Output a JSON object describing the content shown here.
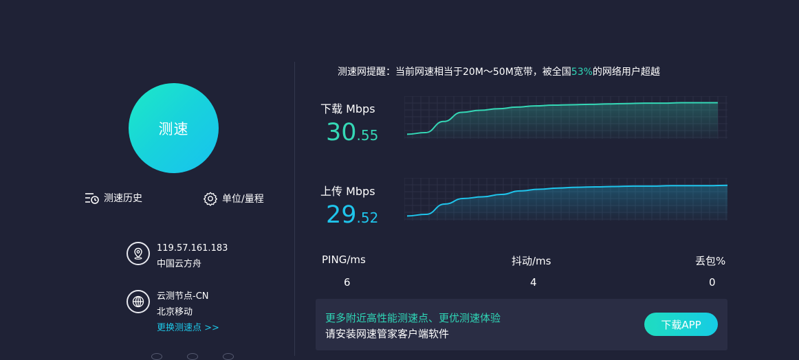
{
  "start_button": {
    "label": "测速"
  },
  "tools": {
    "history_label": "测速历史",
    "settings_label": "单位/量程"
  },
  "ip_info": {
    "ip": "119.57.161.183",
    "isp": "中国云方舟"
  },
  "node_info": {
    "node": "云测节点-CN",
    "carrier": "北京移动",
    "change_link": "更换测速点 >>"
  },
  "tip": {
    "prefix": "测速网提醒：当前网速相当于20M～50M宽带，被全国",
    "percent": "53%",
    "suffix": "的网络用户超越"
  },
  "download": {
    "label": "下载 Mbps",
    "value_int": "30",
    "value_dec": ".55",
    "chart_data": {
      "type": "area",
      "series": [
        {
          "values": [
            0.08,
            0.12,
            0.4,
            0.63,
            0.68,
            0.72,
            0.76,
            0.79,
            0.81,
            0.82,
            0.83,
            0.84,
            0.85,
            0.86,
            0.86,
            0.87,
            0.87,
            0.87
          ]
        }
      ],
      "grid": true,
      "color": "#35d8b6"
    }
  },
  "upload": {
    "label": "上传 Mbps",
    "value_int": "29",
    "value_dec": ".52",
    "chart_data": {
      "type": "area",
      "series": [
        {
          "values": [
            0.08,
            0.12,
            0.38,
            0.52,
            0.56,
            0.62,
            0.71,
            0.75,
            0.78,
            0.8,
            0.81,
            0.82,
            0.83,
            0.83,
            0.84,
            0.84,
            0.84,
            0.85
          ]
        }
      ],
      "grid": true,
      "color": "#1fc5ec"
    }
  },
  "stats": {
    "ping_label": "PING/ms",
    "ping_value": "6",
    "jitter_label": "抖动/ms",
    "jitter_value": "4",
    "loss_label": "丢包%",
    "loss_value": "0"
  },
  "promo": {
    "line1": "更多附近高性能测速点、更优测速体验",
    "line2": "请安装网速管家客户端软件",
    "button_label": "下载APP"
  },
  "colors": {
    "background": "#1f2236",
    "accent_green": "#35d8b6",
    "accent_blue": "#1fc5ec"
  }
}
